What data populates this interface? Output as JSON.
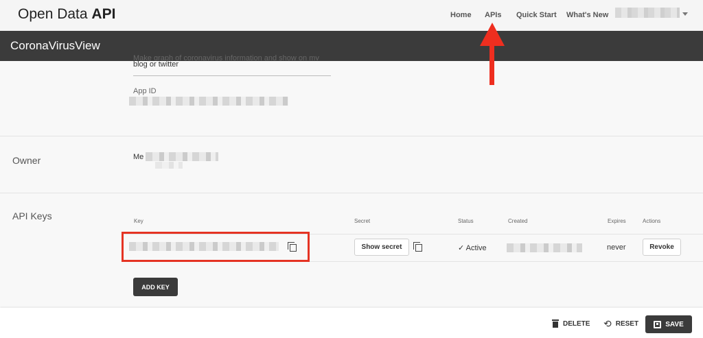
{
  "nav": {
    "brand_light": "Open Data",
    "brand_bold": "API",
    "links": [
      "Home",
      "APIs",
      "Quick Start",
      "What's New"
    ]
  },
  "appbar": {
    "title": "CoronaVirusView"
  },
  "description": {
    "clipped_line": "Make graph of coronavirus information and show on my",
    "visible_line": "blog or twitter"
  },
  "app_id": {
    "label": "App ID"
  },
  "owner": {
    "label": "Owner",
    "value_prefix": "Me"
  },
  "api_keys": {
    "label": "API Keys",
    "columns": [
      "Key",
      "Secret",
      "Status",
      "Created",
      "Expires",
      "Actions"
    ],
    "row": {
      "show_secret_label": "Show secret",
      "status_mark": "✓",
      "status": "Active",
      "expires": "never",
      "revoke_label": "Revoke"
    },
    "add_key_label": "ADD KEY"
  },
  "footer": {
    "delete_label": "DELETE",
    "reset_label": "RESET",
    "save_label": "SAVE"
  },
  "colors": {
    "annotation_red": "#e53323",
    "dark_bar": "#3b3b3b"
  },
  "icons": [
    "caret-down-icon",
    "copy-icon",
    "trash-icon",
    "reset-icon",
    "floppy-icon",
    "up-arrow-annotation"
  ]
}
